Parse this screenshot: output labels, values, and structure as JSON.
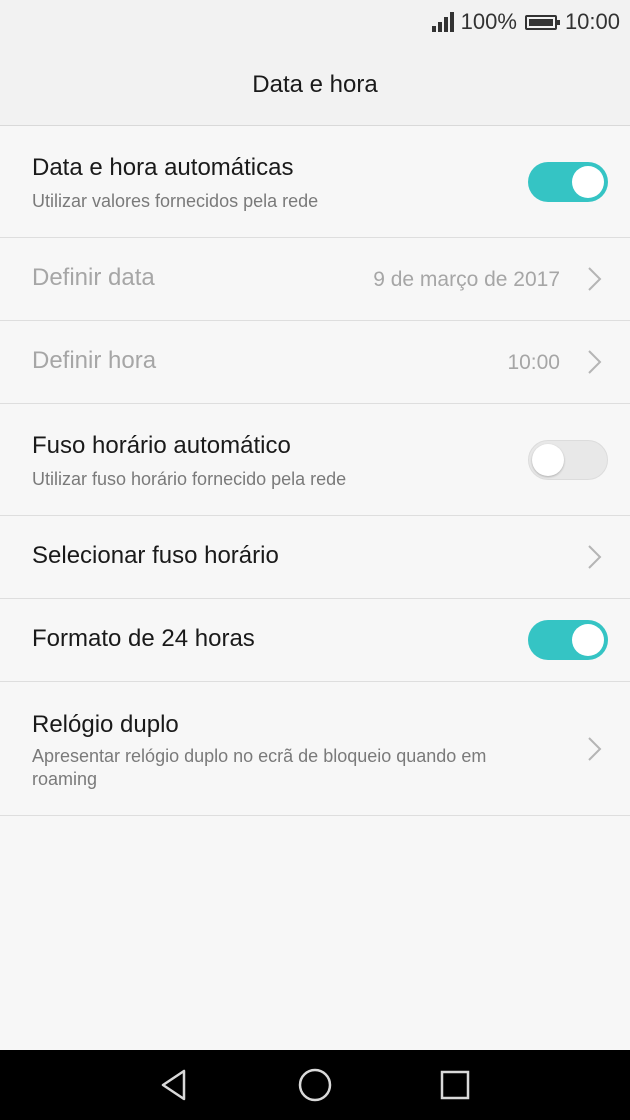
{
  "status_bar": {
    "battery": "100%",
    "time": "10:00",
    "icons": [
      "signal-icon",
      "battery-icon"
    ]
  },
  "header": {
    "title": "Data e hora"
  },
  "settings": [
    {
      "title": "Data e hora automáticas",
      "subtitle": "Utilizar valores fornecidos pela rede",
      "control": "toggle",
      "state": "on"
    },
    {
      "title": "Definir data",
      "value": "9 de março de 2017",
      "control": "chevron",
      "enabled": false
    },
    {
      "title": "Definir hora",
      "value": "10:00",
      "control": "chevron",
      "enabled": false
    },
    {
      "title": "Fuso horário automático",
      "subtitle": "Utilizar fuso horário fornecido pela rede",
      "control": "toggle",
      "state": "off"
    },
    {
      "title": "Selecionar fuso horário",
      "control": "chevron"
    },
    {
      "title": "Formato de 24 horas",
      "control": "toggle",
      "state": "on"
    },
    {
      "title": "Relógio duplo",
      "subtitle": "Apresentar relógio duplo no ecrã de bloqueio quando em roaming",
      "control": "chevron"
    }
  ],
  "nav_bar": {
    "icons": [
      "back-icon",
      "home-icon",
      "recents-icon"
    ]
  },
  "colors": {
    "accent": "#35c4c4",
    "background": "#f7f7f7",
    "nav_bar": "#000000"
  }
}
